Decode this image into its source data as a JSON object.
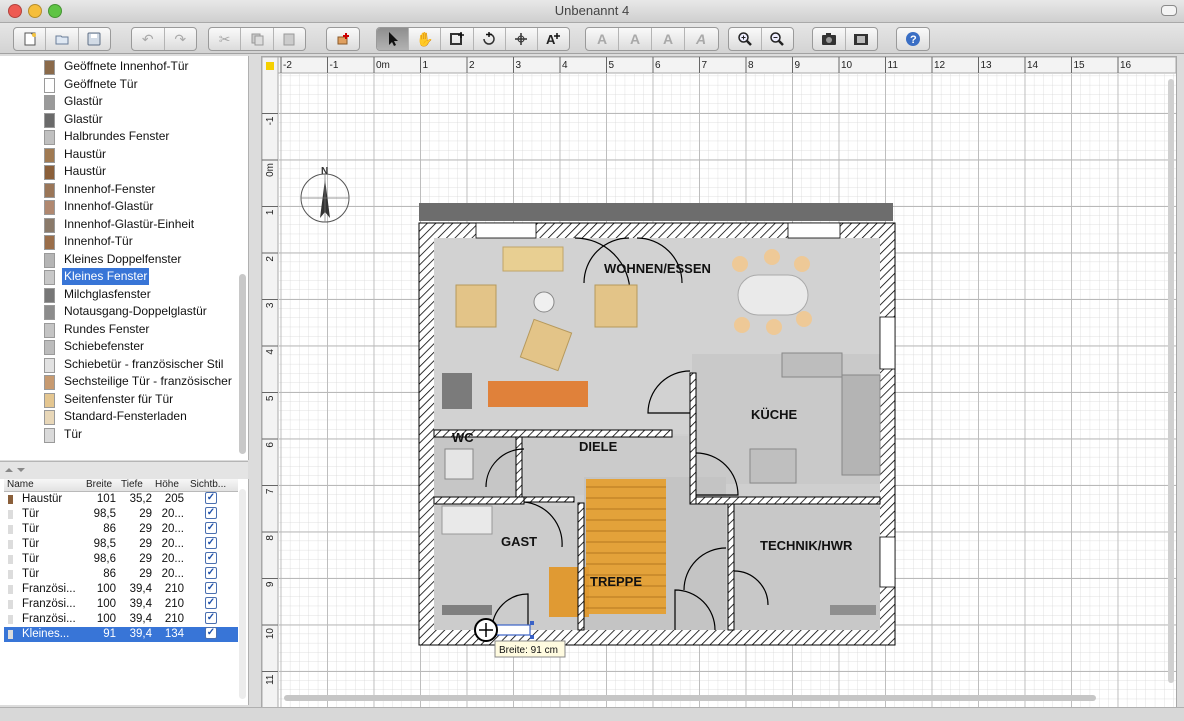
{
  "window": {
    "title": "Unbenannt 4"
  },
  "toolbar": {
    "groups": [
      [
        "new-home-icon",
        "open-icon",
        "save-icon"
      ],
      [
        "undo-icon",
        "redo-icon"
      ],
      [
        "cut-icon",
        "copy-icon",
        "paste-icon"
      ],
      [
        "add-furniture-icon"
      ],
      [
        "select-mode-icon",
        "pan-mode-icon",
        "create-walls-icon",
        "create-rooms-icon",
        "create-dimensions-icon",
        "add-text-icon"
      ],
      [
        "increase-text-icon",
        "decrease-text-icon",
        "bold-text-icon",
        "italic-text-icon"
      ],
      [
        "zoom-in-icon",
        "zoom-out-icon"
      ],
      [
        "create-photo-icon",
        "create-video-icon"
      ],
      [
        "help-icon"
      ]
    ]
  },
  "catalog": {
    "items": [
      {
        "label": "Geöffnete Innenhof-Tür",
        "icon_color": "#8a6a4a"
      },
      {
        "label": "Geöffnete Tür",
        "icon_color": "#ffffff"
      },
      {
        "label": "Glastür",
        "icon_color": "#9a9a9a"
      },
      {
        "label": "Glastür",
        "icon_color": "#6a6a6a"
      },
      {
        "label": "Halbrundes Fenster",
        "icon_color": "#c0c0c0"
      },
      {
        "label": "Haustür",
        "icon_color": "#a07a52"
      },
      {
        "label": "Haustür",
        "icon_color": "#8a5f3a"
      },
      {
        "label": "Innenhof-Fenster",
        "icon_color": "#9a7658"
      },
      {
        "label": "Innenhof-Glastür",
        "icon_color": "#b08870"
      },
      {
        "label": "Innenhof-Glastür-Einheit",
        "icon_color": "#8a7a6a"
      },
      {
        "label": "Innenhof-Tür",
        "icon_color": "#9a6e4a"
      },
      {
        "label": "Kleines Doppelfenster",
        "icon_color": "#b5b5b5"
      },
      {
        "label": "Kleines Fenster",
        "icon_color": "#c8c8c8"
      },
      {
        "label": "Milchglasfenster",
        "icon_color": "#777777"
      },
      {
        "label": "Notausgang-Doppelglastür",
        "icon_color": "#8c8c8c"
      },
      {
        "label": "Rundes Fenster",
        "icon_color": "#c4c4c4"
      },
      {
        "label": "Schiebefenster",
        "icon_color": "#bcbcbc"
      },
      {
        "label": "Schiebetür - französischer Stil",
        "icon_color": "#e2e2e2"
      },
      {
        "label": "Sechsteilige Tür - französischer",
        "icon_color": "#c79a70"
      },
      {
        "label": "Seitenfenster für Tür",
        "icon_color": "#e4c690"
      },
      {
        "label": "Standard-Fensterladen",
        "icon_color": "#e8d7b8"
      },
      {
        "label": "Tür",
        "icon_color": "#dadada"
      }
    ],
    "selected_index": 12
  },
  "furniture_table": {
    "headers": [
      "Name",
      "Breite",
      "Tiefe",
      "Höhe",
      "Sichtb..."
    ],
    "rows": [
      {
        "name": "Haustür",
        "breite": "101",
        "tiefe": "35,2",
        "hoehe": "205",
        "visible": true
      },
      {
        "name": "Tür",
        "breite": "98,5",
        "tiefe": "29",
        "hoehe": "20...",
        "visible": true
      },
      {
        "name": "Tür",
        "breite": "86",
        "tiefe": "29",
        "hoehe": "20...",
        "visible": true
      },
      {
        "name": "Tür",
        "breite": "98,5",
        "tiefe": "29",
        "hoehe": "20...",
        "visible": true
      },
      {
        "name": "Tür",
        "breite": "98,6",
        "tiefe": "29",
        "hoehe": "20...",
        "visible": true
      },
      {
        "name": "Tür",
        "breite": "86",
        "tiefe": "29",
        "hoehe": "20...",
        "visible": true
      },
      {
        "name": "Französi...",
        "breite": "100",
        "tiefe": "39,4",
        "hoehe": "210",
        "visible": true
      },
      {
        "name": "Französi...",
        "breite": "100",
        "tiefe": "39,4",
        "hoehe": "210",
        "visible": true
      },
      {
        "name": "Französi...",
        "breite": "100",
        "tiefe": "39,4",
        "hoehe": "210",
        "visible": true
      },
      {
        "name": "Kleines...",
        "breite": "91",
        "tiefe": "39,4",
        "hoehe": "134",
        "visible": true
      }
    ],
    "selected_index": 9
  },
  "plan": {
    "ruler_x_labels": [
      "-2",
      "-1",
      "0m",
      "1",
      "2",
      "3",
      "4",
      "5",
      "6",
      "7",
      "8",
      "9",
      "10",
      "11",
      "12",
      "13",
      "14",
      "15",
      "16"
    ],
    "ruler_y_labels": [
      "-1",
      "0m",
      "1",
      "2",
      "3",
      "4",
      "5",
      "6",
      "7",
      "8",
      "9",
      "10",
      "11"
    ],
    "compass_label": "N",
    "rooms": {
      "wohnen": "WOHNEN/ESSEN",
      "kueche": "KÜCHE",
      "diele": "DIELE",
      "wc": "WC",
      "gast": "GAST",
      "treppe": "TREPPE",
      "technik": "TECHNIK/HWR"
    },
    "tooltip": "Breite: 91 cm"
  }
}
